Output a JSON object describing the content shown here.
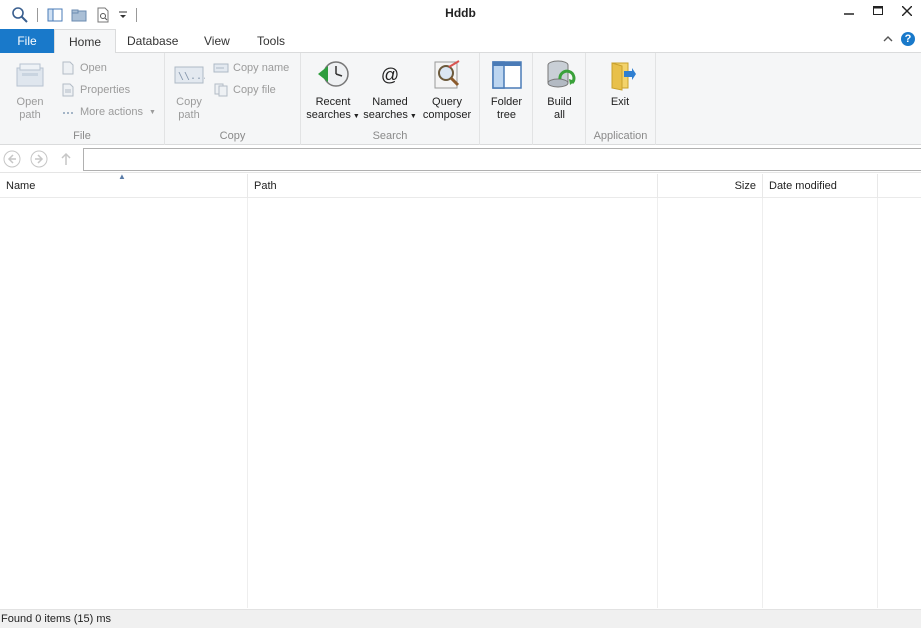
{
  "window": {
    "title": "Hddb"
  },
  "tabs": {
    "file": "File",
    "home": "Home",
    "database": "Database",
    "view": "View",
    "tools": "Tools"
  },
  "ribbon": {
    "file_group": {
      "label": "File",
      "open_path": [
        "Open",
        "path"
      ],
      "open": "Open",
      "properties": "Properties",
      "more_actions": "More actions"
    },
    "copy_group": {
      "label": "Copy",
      "copy_path": [
        "Copy",
        "path"
      ],
      "copy_name": "Copy name",
      "copy_file": "Copy file"
    },
    "search_group": {
      "label": "Search",
      "recent": [
        "Recent",
        "searches"
      ],
      "named": [
        "Named",
        "searches"
      ],
      "query": [
        "Query",
        "composer"
      ]
    },
    "folder_tree": [
      "Folder",
      "tree"
    ],
    "build_all": [
      "Build",
      "all"
    ],
    "app_group": {
      "label": "Application",
      "exit": "Exit"
    }
  },
  "address": {
    "value": ""
  },
  "columns": {
    "name": "Name",
    "path": "Path",
    "size": "Size",
    "date": "Date modified"
  },
  "status": {
    "text": "Found 0 items (15) ms"
  },
  "colors": {
    "accent": "#1979ca",
    "ribbon_bg": "#f5f6f7"
  }
}
